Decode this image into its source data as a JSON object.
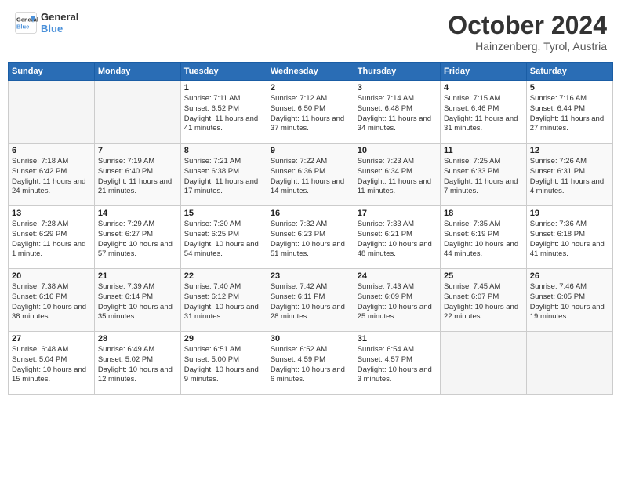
{
  "header": {
    "logo_line1": "General",
    "logo_line2": "Blue",
    "month": "October 2024",
    "location": "Hainzenberg, Tyrol, Austria"
  },
  "weekdays": [
    "Sunday",
    "Monday",
    "Tuesday",
    "Wednesday",
    "Thursday",
    "Friday",
    "Saturday"
  ],
  "weeks": [
    [
      {
        "day": "",
        "info": ""
      },
      {
        "day": "",
        "info": ""
      },
      {
        "day": "1",
        "info": "Sunrise: 7:11 AM\nSunset: 6:52 PM\nDaylight: 11 hours and 41 minutes."
      },
      {
        "day": "2",
        "info": "Sunrise: 7:12 AM\nSunset: 6:50 PM\nDaylight: 11 hours and 37 minutes."
      },
      {
        "day": "3",
        "info": "Sunrise: 7:14 AM\nSunset: 6:48 PM\nDaylight: 11 hours and 34 minutes."
      },
      {
        "day": "4",
        "info": "Sunrise: 7:15 AM\nSunset: 6:46 PM\nDaylight: 11 hours and 31 minutes."
      },
      {
        "day": "5",
        "info": "Sunrise: 7:16 AM\nSunset: 6:44 PM\nDaylight: 11 hours and 27 minutes."
      }
    ],
    [
      {
        "day": "6",
        "info": "Sunrise: 7:18 AM\nSunset: 6:42 PM\nDaylight: 11 hours and 24 minutes."
      },
      {
        "day": "7",
        "info": "Sunrise: 7:19 AM\nSunset: 6:40 PM\nDaylight: 11 hours and 21 minutes."
      },
      {
        "day": "8",
        "info": "Sunrise: 7:21 AM\nSunset: 6:38 PM\nDaylight: 11 hours and 17 minutes."
      },
      {
        "day": "9",
        "info": "Sunrise: 7:22 AM\nSunset: 6:36 PM\nDaylight: 11 hours and 14 minutes."
      },
      {
        "day": "10",
        "info": "Sunrise: 7:23 AM\nSunset: 6:34 PM\nDaylight: 11 hours and 11 minutes."
      },
      {
        "day": "11",
        "info": "Sunrise: 7:25 AM\nSunset: 6:33 PM\nDaylight: 11 hours and 7 minutes."
      },
      {
        "day": "12",
        "info": "Sunrise: 7:26 AM\nSunset: 6:31 PM\nDaylight: 11 hours and 4 minutes."
      }
    ],
    [
      {
        "day": "13",
        "info": "Sunrise: 7:28 AM\nSunset: 6:29 PM\nDaylight: 11 hours and 1 minute."
      },
      {
        "day": "14",
        "info": "Sunrise: 7:29 AM\nSunset: 6:27 PM\nDaylight: 10 hours and 57 minutes."
      },
      {
        "day": "15",
        "info": "Sunrise: 7:30 AM\nSunset: 6:25 PM\nDaylight: 10 hours and 54 minutes."
      },
      {
        "day": "16",
        "info": "Sunrise: 7:32 AM\nSunset: 6:23 PM\nDaylight: 10 hours and 51 minutes."
      },
      {
        "day": "17",
        "info": "Sunrise: 7:33 AM\nSunset: 6:21 PM\nDaylight: 10 hours and 48 minutes."
      },
      {
        "day": "18",
        "info": "Sunrise: 7:35 AM\nSunset: 6:19 PM\nDaylight: 10 hours and 44 minutes."
      },
      {
        "day": "19",
        "info": "Sunrise: 7:36 AM\nSunset: 6:18 PM\nDaylight: 10 hours and 41 minutes."
      }
    ],
    [
      {
        "day": "20",
        "info": "Sunrise: 7:38 AM\nSunset: 6:16 PM\nDaylight: 10 hours and 38 minutes."
      },
      {
        "day": "21",
        "info": "Sunrise: 7:39 AM\nSunset: 6:14 PM\nDaylight: 10 hours and 35 minutes."
      },
      {
        "day": "22",
        "info": "Sunrise: 7:40 AM\nSunset: 6:12 PM\nDaylight: 10 hours and 31 minutes."
      },
      {
        "day": "23",
        "info": "Sunrise: 7:42 AM\nSunset: 6:11 PM\nDaylight: 10 hours and 28 minutes."
      },
      {
        "day": "24",
        "info": "Sunrise: 7:43 AM\nSunset: 6:09 PM\nDaylight: 10 hours and 25 minutes."
      },
      {
        "day": "25",
        "info": "Sunrise: 7:45 AM\nSunset: 6:07 PM\nDaylight: 10 hours and 22 minutes."
      },
      {
        "day": "26",
        "info": "Sunrise: 7:46 AM\nSunset: 6:05 PM\nDaylight: 10 hours and 19 minutes."
      }
    ],
    [
      {
        "day": "27",
        "info": "Sunrise: 6:48 AM\nSunset: 5:04 PM\nDaylight: 10 hours and 15 minutes."
      },
      {
        "day": "28",
        "info": "Sunrise: 6:49 AM\nSunset: 5:02 PM\nDaylight: 10 hours and 12 minutes."
      },
      {
        "day": "29",
        "info": "Sunrise: 6:51 AM\nSunset: 5:00 PM\nDaylight: 10 hours and 9 minutes."
      },
      {
        "day": "30",
        "info": "Sunrise: 6:52 AM\nSunset: 4:59 PM\nDaylight: 10 hours and 6 minutes."
      },
      {
        "day": "31",
        "info": "Sunrise: 6:54 AM\nSunset: 4:57 PM\nDaylight: 10 hours and 3 minutes."
      },
      {
        "day": "",
        "info": ""
      },
      {
        "day": "",
        "info": ""
      }
    ]
  ]
}
